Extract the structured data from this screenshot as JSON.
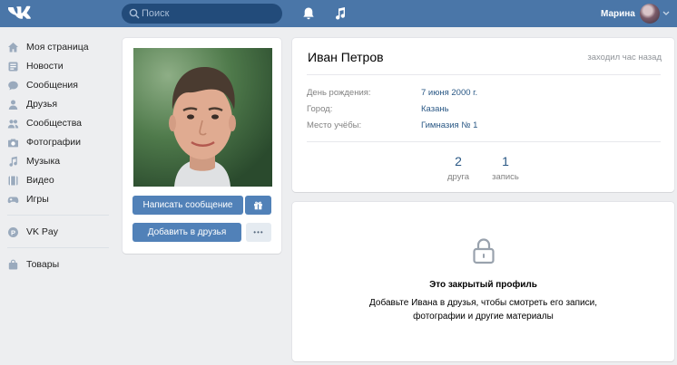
{
  "header": {
    "search_placeholder": "Поиск",
    "user_name": "Марина",
    "accent": "#4a76a8"
  },
  "sidebar": {
    "items": [
      {
        "label": "Моя страница",
        "icon": "home-icon"
      },
      {
        "label": "Новости",
        "icon": "news-icon"
      },
      {
        "label": "Сообщения",
        "icon": "message-icon"
      },
      {
        "label": "Друзья",
        "icon": "friends-icon"
      },
      {
        "label": "Сообщества",
        "icon": "groups-icon"
      },
      {
        "label": "Фотографии",
        "icon": "camera-icon"
      },
      {
        "label": "Музыка",
        "icon": "music-icon"
      },
      {
        "label": "Видео",
        "icon": "video-icon"
      },
      {
        "label": "Игры",
        "icon": "gamepad-icon"
      },
      {
        "label": "VK Pay",
        "icon": "vkpay-icon"
      },
      {
        "label": "Товары",
        "icon": "bag-icon"
      }
    ]
  },
  "profile": {
    "name": "Иван Петров",
    "last_seen": "заходил час назад",
    "fields": [
      {
        "label": "День рождения:",
        "value": "7 июня 2000 г."
      },
      {
        "label": "Город:",
        "value": "Казань"
      },
      {
        "label": "Место учёбы:",
        "value": "Гимназия № 1"
      }
    ],
    "counters": [
      {
        "num": "2",
        "label": "друга"
      },
      {
        "num": "1",
        "label": "запись"
      }
    ]
  },
  "actions": {
    "message_button": "Написать сообщение",
    "add_friend_button": "Добавить в друзья",
    "more_label": "•••"
  },
  "closed": {
    "title": "Это закрытый профиль",
    "text": "Добавьте Ивана в друзья, чтобы смотреть его записи, фотографии и другие материалы"
  }
}
